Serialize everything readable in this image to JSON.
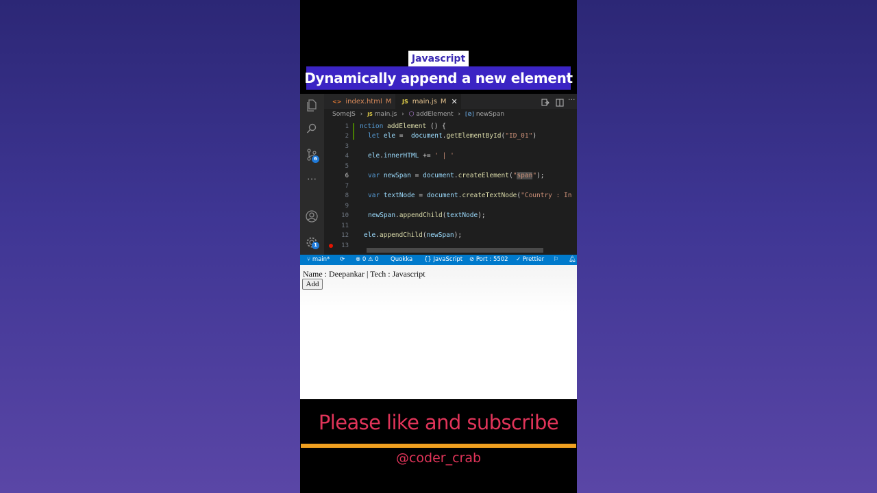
{
  "video": {
    "tag": "Javascript",
    "headline": "Dynamically append a new element",
    "cta": "Please like and subscribe",
    "handle": "@coder_crab"
  },
  "editor": {
    "tabs": [
      {
        "icon": "<>",
        "label": "index.html",
        "modified": "M",
        "active": false
      },
      {
        "icon": "JS",
        "label": "main.js",
        "modified": "M",
        "active": true
      }
    ],
    "breadcrumb": [
      "SomeJS",
      "main.js",
      "addElement",
      "newSpan"
    ],
    "activity_badges": {
      "source_control": "6",
      "settings": "1"
    },
    "lines": [
      {
        "n": "1",
        "code": "nction addElement () {"
      },
      {
        "n": "2",
        "code": "let ele =  document.getElementById(\"ID_01\")"
      },
      {
        "n": "3",
        "code": ""
      },
      {
        "n": "4",
        "code": "ele.innerHTML += ' | '"
      },
      {
        "n": "5",
        "code": ""
      },
      {
        "n": "6",
        "code": "var newSpan = document.createElement(\"span\");"
      },
      {
        "n": "7",
        "code": ""
      },
      {
        "n": "8",
        "code": "var textNode = document.createTextNode(\"Country : In"
      },
      {
        "n": "9",
        "code": ""
      },
      {
        "n": "10",
        "code": "newSpan.appendChild(textNode);"
      },
      {
        "n": "11",
        "code": ""
      },
      {
        "n": "12",
        "code": "ele.appendChild(newSpan);"
      },
      {
        "n": "13",
        "code": ""
      }
    ],
    "code_tokens": {
      "l1_a": "nction ",
      "l1_b": "addElement",
      "l1_c": " () {",
      "l2_a": "let ",
      "l2_b": "ele",
      "l2_c": " =  ",
      "l2_d": "document",
      "l2_e": ".",
      "l2_f": "getElementById",
      "l2_g": "(",
      "l2_h": "\"ID_01\"",
      "l2_i": ")",
      "l4_a": "ele",
      "l4_b": ".",
      "l4_c": "innerHTML",
      "l4_d": " += ",
      "l4_e": "' | '",
      "l6_a": "var ",
      "l6_b": "newSpan",
      "l6_c": " = ",
      "l6_d": "document",
      "l6_e": ".",
      "l6_f": "createElement",
      "l6_g": "(",
      "l6_h": "\"",
      "l6_i": "span",
      "l6_j": "\"",
      "l6_k": ");",
      "l8_a": "var ",
      "l8_b": "textNode",
      "l8_c": " = ",
      "l8_d": "document",
      "l8_e": ".",
      "l8_f": "createTextNode",
      "l8_g": "(",
      "l8_h": "\"Country : In",
      "l10_a": "newSpan",
      "l10_b": ".",
      "l10_c": "appendChild",
      "l10_d": "(",
      "l10_e": "textNode",
      "l10_f": ");",
      "l12_a": "ele",
      "l12_b": ".",
      "l12_c": "appendChild",
      "l12_d": "(",
      "l12_e": "newSpan",
      "l12_f": ");"
    }
  },
  "statusbar": {
    "branch": "main*",
    "errors": "0",
    "warnings": "0",
    "quokka": "Quokka",
    "language": "JavaScript",
    "port": "Port : 5502",
    "prettier": "Prettier"
  },
  "browser": {
    "text": "Name : Deepankar | Tech : Javascript",
    "button_label": "Add"
  },
  "colors": {
    "statusbar": "#007acc",
    "headline_bg": "#3b24c4",
    "cta": "#e03459",
    "gold": "#f0a020"
  }
}
